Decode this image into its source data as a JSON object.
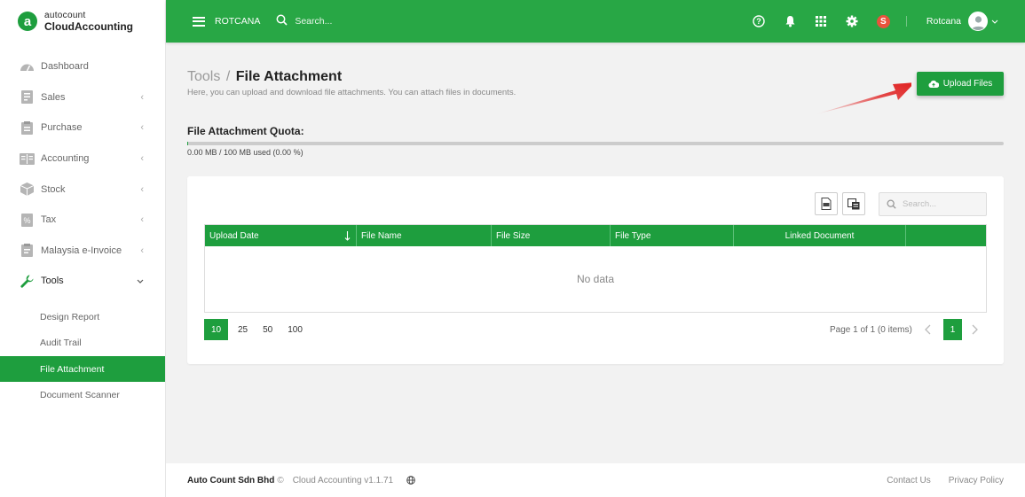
{
  "brand": {
    "top": "autocount",
    "bottom": "CloudAccounting",
    "logo_letter": "a"
  },
  "sidebar": {
    "items": [
      {
        "label": "Dashboard",
        "icon": "dashboard-icon"
      },
      {
        "label": "Sales",
        "icon": "sales-icon"
      },
      {
        "label": "Purchase",
        "icon": "purchase-icon"
      },
      {
        "label": "Accounting",
        "icon": "accounting-icon"
      },
      {
        "label": "Stock",
        "icon": "stock-icon"
      },
      {
        "label": "Tax",
        "icon": "tax-icon"
      },
      {
        "label": "Malaysia e-Invoice",
        "icon": "einvoice-icon"
      },
      {
        "label": "Tools",
        "icon": "wrench-icon"
      }
    ],
    "tools_sub": [
      "Design Report",
      "Audit Trail",
      "File Attachment",
      "Document Scanner"
    ],
    "active_sub": "File Attachment"
  },
  "topbar": {
    "company": "ROTCANA",
    "search_placeholder": "Search...",
    "badge_letter": "S",
    "username": "Rotcana"
  },
  "page": {
    "title_parent": "Tools",
    "title_sep": "/",
    "title_current": "File Attachment",
    "description": "Here, you can upload and download file attachments. You can attach files in documents.",
    "upload_label": "Upload Files"
  },
  "quota": {
    "title": "File Attachment Quota:",
    "text": "0.00 MB / 100 MB used (0.00 %)",
    "percent": 0
  },
  "grid": {
    "search_placeholder": "Search...",
    "columns": [
      "Upload Date",
      "File Name",
      "File Size",
      "File Type",
      "Linked Document",
      ""
    ],
    "empty_text": "No data",
    "page_sizes": [
      "10",
      "25",
      "50",
      "100"
    ],
    "selected_page_size": "10",
    "page_info": "Page 1 of 1 (0 items)",
    "current_page": "1"
  },
  "footer": {
    "company": "Auto Count Sdn Bhd",
    "copyright": "©",
    "version": "Cloud Accounting v1.1.71",
    "links": [
      "Contact Us",
      "Privacy Policy"
    ]
  },
  "colors": {
    "primary": "#1e9e3e",
    "topbar": "#28a745",
    "badge": "#e8533c",
    "arrow": "#e02020"
  }
}
